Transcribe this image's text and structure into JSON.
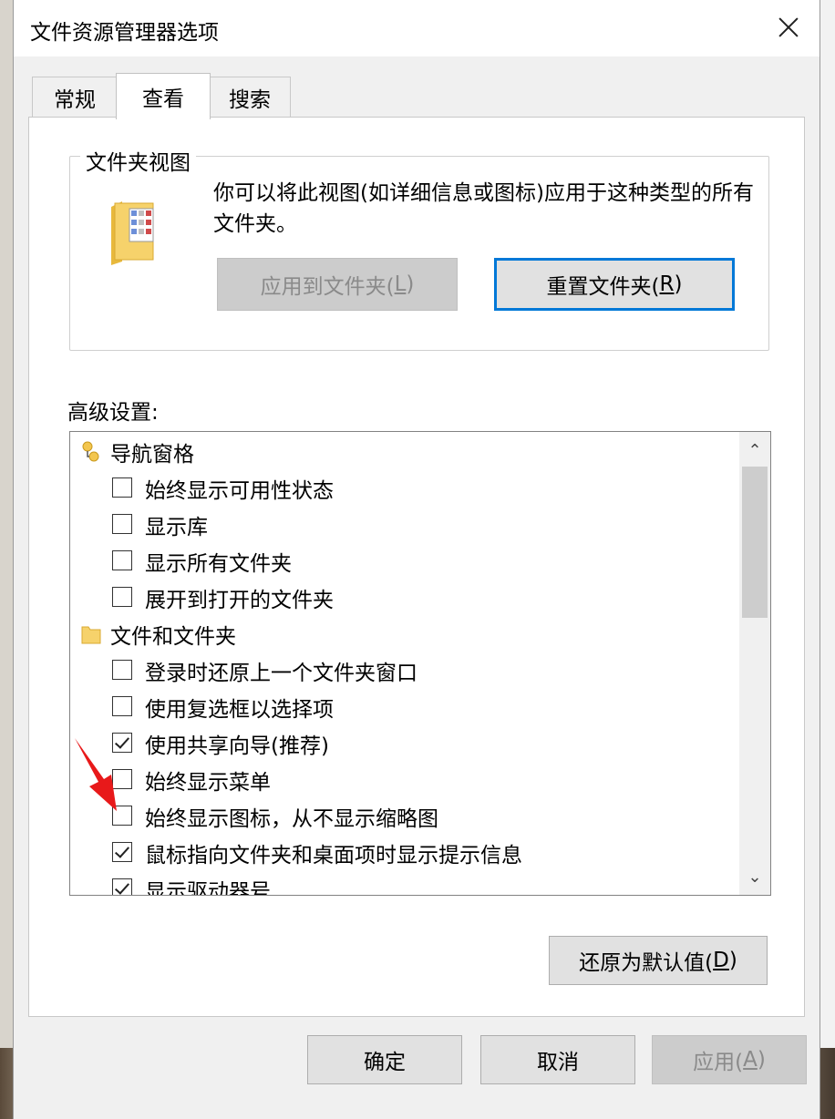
{
  "window": {
    "title": "文件资源管理器选项"
  },
  "tabs": [
    {
      "label": "常规"
    },
    {
      "label": "查看"
    },
    {
      "label": "搜索"
    }
  ],
  "folder_views": {
    "group_label": "文件夹视图",
    "description": "你可以将此视图(如详细信息或图标)应用于这种类型的所有文件夹。",
    "apply_button": {
      "text": "应用到文件夹(",
      "key": "L",
      "end": ")"
    },
    "reset_button": {
      "text": "重置文件夹(",
      "key": "R",
      "end": ")"
    }
  },
  "advanced": {
    "label": "高级设置:",
    "rows": [
      {
        "type": "category",
        "label": "导航窗格",
        "icon": "navigation-pane-icon"
      },
      {
        "type": "option",
        "label": "始终显示可用性状态",
        "checked": false
      },
      {
        "type": "option",
        "label": "显示库",
        "checked": false
      },
      {
        "type": "option",
        "label": "显示所有文件夹",
        "checked": false
      },
      {
        "type": "option",
        "label": "展开到打开的文件夹",
        "checked": false
      },
      {
        "type": "category",
        "label": "文件和文件夹",
        "icon": "folder-icon"
      },
      {
        "type": "option",
        "label": "登录时还原上一个文件夹窗口",
        "checked": false
      },
      {
        "type": "option",
        "label": "使用复选框以选择项",
        "checked": false
      },
      {
        "type": "option",
        "label": "使用共享向导(推荐)",
        "checked": true
      },
      {
        "type": "option",
        "label": "始终显示菜单",
        "checked": false
      },
      {
        "type": "option",
        "label": "始终显示图标，从不显示缩略图",
        "checked": false
      },
      {
        "type": "option",
        "label": "鼠标指向文件夹和桌面项时显示提示信息",
        "checked": true
      },
      {
        "type": "option",
        "label": "显示驱动器号",
        "checked": true
      }
    ]
  },
  "restore_defaults": {
    "text": "还原为默认值(",
    "key": "D",
    "end": ")"
  },
  "footer": {
    "ok": "确定",
    "cancel": "取消",
    "apply": {
      "text": "应用(",
      "key": "A",
      "end": ")"
    }
  },
  "colors": {
    "focus_border": "#0078d7",
    "folder": "#f6d26b",
    "annotation_arrow": "#e8191a"
  }
}
